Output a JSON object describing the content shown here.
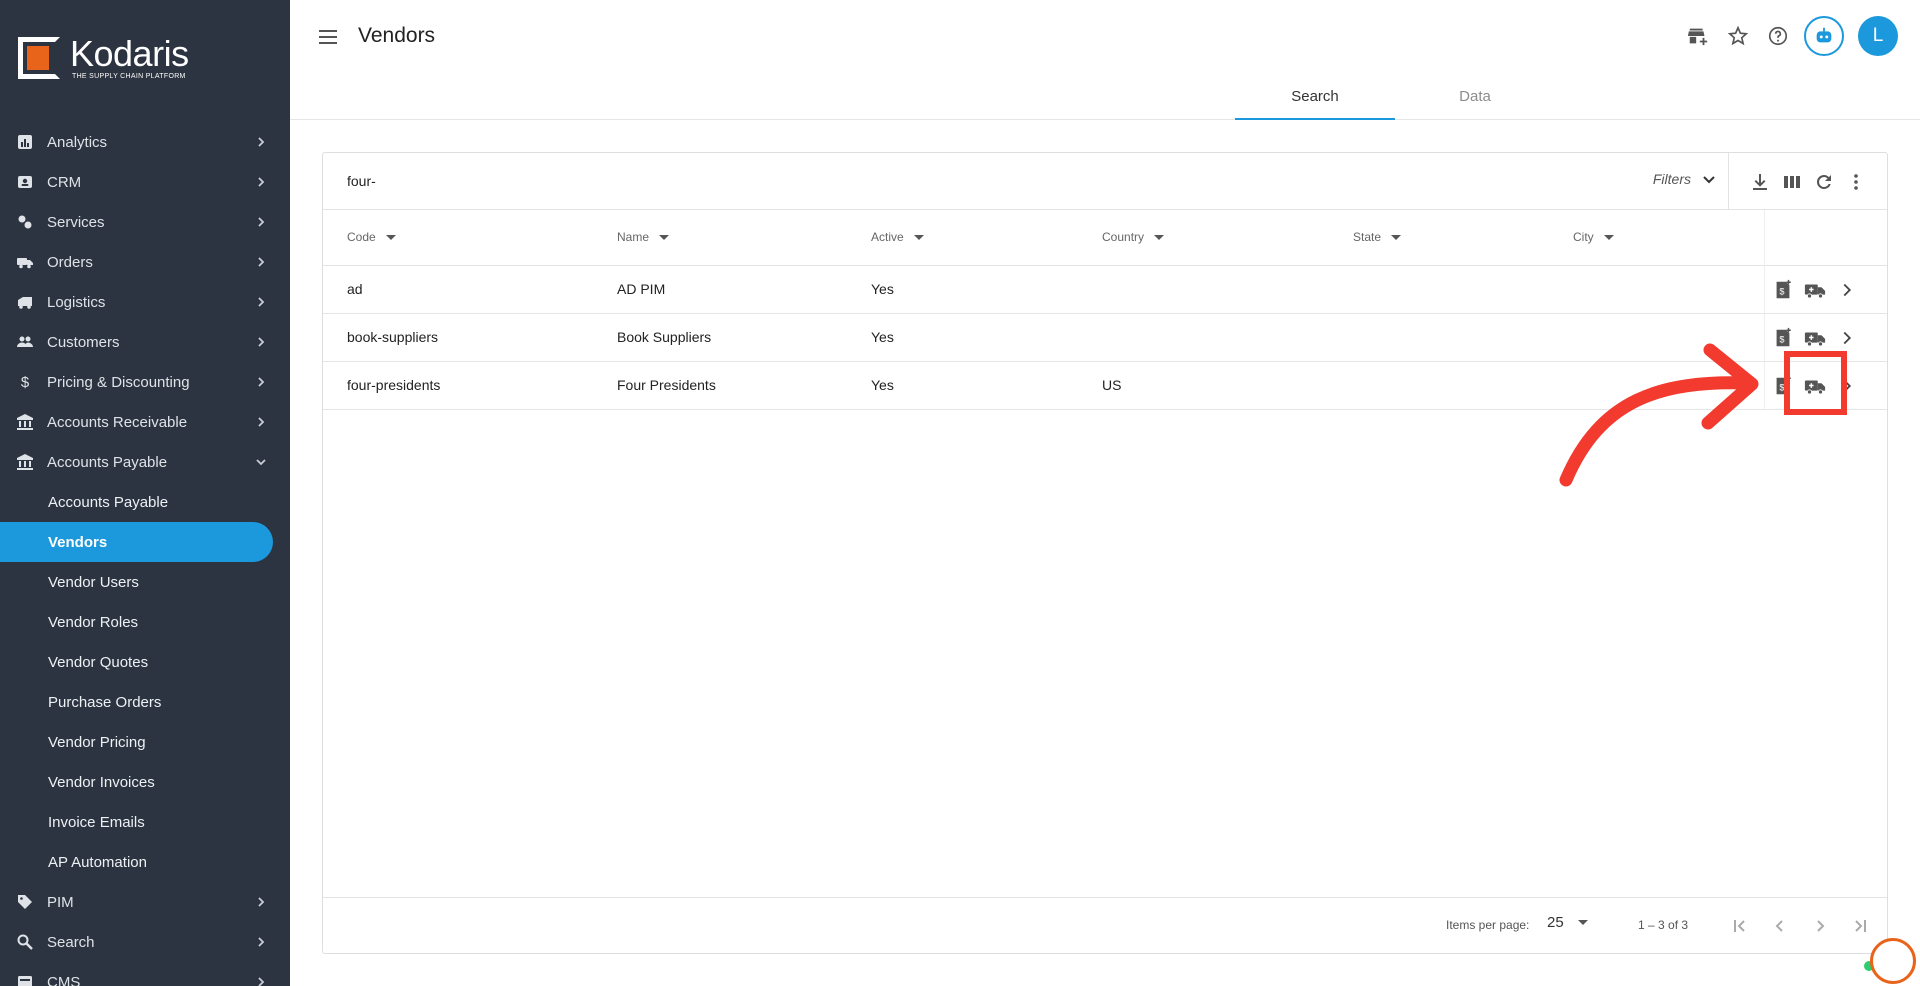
{
  "brand": {
    "name": "Kodaris",
    "tagline": "THE SUPPLY CHAIN PLATFORM",
    "accent": "#e8641b",
    "primary": "#1c98dc"
  },
  "sidebar": {
    "items": [
      {
        "label": "Analytics",
        "icon": "analytics-icon"
      },
      {
        "label": "CRM",
        "icon": "crm-icon"
      },
      {
        "label": "Services",
        "icon": "services-icon"
      },
      {
        "label": "Orders",
        "icon": "truck-icon"
      },
      {
        "label": "Logistics",
        "icon": "logistics-icon"
      },
      {
        "label": "Customers",
        "icon": "people-icon"
      },
      {
        "label": "Pricing & Discounting",
        "icon": "dollar-icon"
      },
      {
        "label": "Accounts Receivable",
        "icon": "bank-icon"
      },
      {
        "label": "Accounts Payable",
        "icon": "bank-icon",
        "expanded": true
      }
    ],
    "sub_items": [
      "Accounts Payable",
      "Vendors",
      "Vendor Users",
      "Vendor Roles",
      "Vendor Quotes",
      "Purchase Orders",
      "Vendor Pricing",
      "Vendor Invoices",
      "Invoice Emails",
      "AP Automation"
    ],
    "active_sub": "Vendors",
    "bottom_items": [
      {
        "label": "PIM",
        "icon": "tag-icon"
      },
      {
        "label": "Search",
        "icon": "search-icon"
      },
      {
        "label": "CMS",
        "icon": "cms-icon"
      }
    ]
  },
  "header": {
    "title": "Vendors",
    "avatar_initial": "L",
    "tabs": [
      "Search",
      "Data"
    ],
    "active_tab": "Search"
  },
  "table": {
    "search_value": "four-",
    "filters_label": "Filters",
    "columns": [
      "Code",
      "Name",
      "Active",
      "Country",
      "State",
      "City"
    ],
    "rows": [
      {
        "code": "ad",
        "name": "AD PIM",
        "active": "Yes",
        "country": "",
        "state": "",
        "city": ""
      },
      {
        "code": "book-suppliers",
        "name": "Book Suppliers",
        "active": "Yes",
        "country": "",
        "state": "",
        "city": ""
      },
      {
        "code": "four-presidents",
        "name": "Four Presidents",
        "active": "Yes",
        "country": "US",
        "state": "",
        "city": ""
      }
    ]
  },
  "pagination": {
    "items_per_page_label": "Items per page:",
    "items_per_page": "25",
    "range": "1 – 3 of 3"
  },
  "annotation": {
    "color": "#f23a2e",
    "highlighted": "four-presidents vendor shipping action"
  }
}
